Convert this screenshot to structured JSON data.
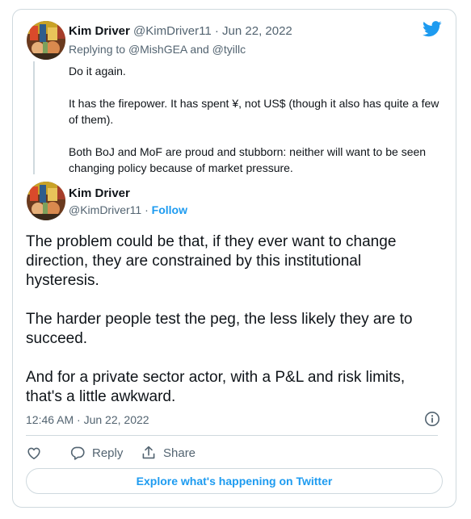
{
  "reply_tweet": {
    "author_name": "Kim Driver",
    "author_handle": "@KimDriver11",
    "separator": "·",
    "date": "Jun 22, 2022",
    "replying_prefix": "Replying to",
    "mention_1": "@MishGEA",
    "mention_join": "and",
    "mention_2": "@tyillc",
    "paragraphs": [
      "Do it again.",
      "It has the firepower.  It has spent ¥, not US$ (though it also has quite a few of them).",
      "Both BoJ and MoF are proud and stubborn: neither will want to be seen changing policy because of market pressure."
    ]
  },
  "main_tweet": {
    "author_name": "Kim Driver",
    "author_handle": "@KimDriver11",
    "separator": "·",
    "follow_label": "Follow",
    "paragraphs": [
      "The problem could be that, if they ever want to change direction, they are constrained by this institutional hysteresis.",
      "The harder people test the peg, the less likely they are to succeed.",
      "And for a private sector actor, with a P&L and risk limits, that's a little awkward."
    ],
    "timestamp": "12:46 AM · Jun 22, 2022"
  },
  "actions": {
    "reply_label": "Reply",
    "share_label": "Share"
  },
  "explore_label": "Explore what's happening on Twitter",
  "colors": {
    "accent": "#1d9bf0",
    "secondary_text": "#536471",
    "border": "#cfd9de"
  },
  "icons": [
    "twitter-bird-icon",
    "info-icon",
    "heart-icon",
    "reply-bubble-icon",
    "share-icon"
  ]
}
